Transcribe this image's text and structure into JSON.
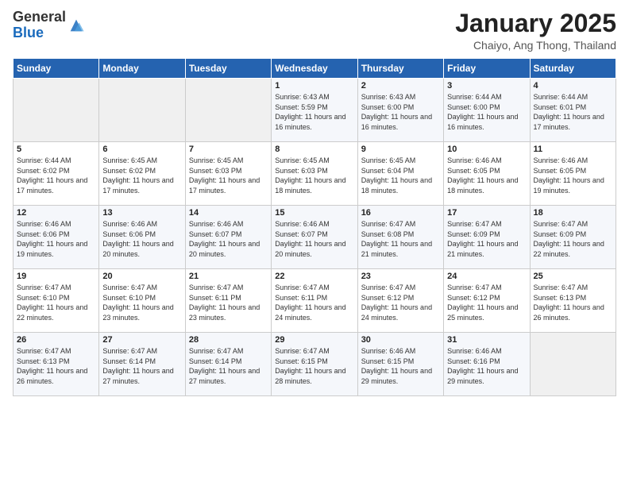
{
  "logo": {
    "general": "General",
    "blue": "Blue"
  },
  "header": {
    "month": "January 2025",
    "location": "Chaiyo, Ang Thong, Thailand"
  },
  "weekdays": [
    "Sunday",
    "Monday",
    "Tuesday",
    "Wednesday",
    "Thursday",
    "Friday",
    "Saturday"
  ],
  "weeks": [
    [
      {
        "day": "",
        "sunrise": "",
        "sunset": "",
        "daylight": ""
      },
      {
        "day": "",
        "sunrise": "",
        "sunset": "",
        "daylight": ""
      },
      {
        "day": "",
        "sunrise": "",
        "sunset": "",
        "daylight": ""
      },
      {
        "day": "1",
        "sunrise": "6:43 AM",
        "sunset": "5:59 PM",
        "daylight": "11 hours and 16 minutes."
      },
      {
        "day": "2",
        "sunrise": "6:43 AM",
        "sunset": "6:00 PM",
        "daylight": "11 hours and 16 minutes."
      },
      {
        "day": "3",
        "sunrise": "6:44 AM",
        "sunset": "6:00 PM",
        "daylight": "11 hours and 16 minutes."
      },
      {
        "day": "4",
        "sunrise": "6:44 AM",
        "sunset": "6:01 PM",
        "daylight": "11 hours and 17 minutes."
      }
    ],
    [
      {
        "day": "5",
        "sunrise": "6:44 AM",
        "sunset": "6:02 PM",
        "daylight": "11 hours and 17 minutes."
      },
      {
        "day": "6",
        "sunrise": "6:45 AM",
        "sunset": "6:02 PM",
        "daylight": "11 hours and 17 minutes."
      },
      {
        "day": "7",
        "sunrise": "6:45 AM",
        "sunset": "6:03 PM",
        "daylight": "11 hours and 17 minutes."
      },
      {
        "day": "8",
        "sunrise": "6:45 AM",
        "sunset": "6:03 PM",
        "daylight": "11 hours and 18 minutes."
      },
      {
        "day": "9",
        "sunrise": "6:45 AM",
        "sunset": "6:04 PM",
        "daylight": "11 hours and 18 minutes."
      },
      {
        "day": "10",
        "sunrise": "6:46 AM",
        "sunset": "6:05 PM",
        "daylight": "11 hours and 18 minutes."
      },
      {
        "day": "11",
        "sunrise": "6:46 AM",
        "sunset": "6:05 PM",
        "daylight": "11 hours and 19 minutes."
      }
    ],
    [
      {
        "day": "12",
        "sunrise": "6:46 AM",
        "sunset": "6:06 PM",
        "daylight": "11 hours and 19 minutes."
      },
      {
        "day": "13",
        "sunrise": "6:46 AM",
        "sunset": "6:06 PM",
        "daylight": "11 hours and 20 minutes."
      },
      {
        "day": "14",
        "sunrise": "6:46 AM",
        "sunset": "6:07 PM",
        "daylight": "11 hours and 20 minutes."
      },
      {
        "day": "15",
        "sunrise": "6:46 AM",
        "sunset": "6:07 PM",
        "daylight": "11 hours and 20 minutes."
      },
      {
        "day": "16",
        "sunrise": "6:47 AM",
        "sunset": "6:08 PM",
        "daylight": "11 hours and 21 minutes."
      },
      {
        "day": "17",
        "sunrise": "6:47 AM",
        "sunset": "6:09 PM",
        "daylight": "11 hours and 21 minutes."
      },
      {
        "day": "18",
        "sunrise": "6:47 AM",
        "sunset": "6:09 PM",
        "daylight": "11 hours and 22 minutes."
      }
    ],
    [
      {
        "day": "19",
        "sunrise": "6:47 AM",
        "sunset": "6:10 PM",
        "daylight": "11 hours and 22 minutes."
      },
      {
        "day": "20",
        "sunrise": "6:47 AM",
        "sunset": "6:10 PM",
        "daylight": "11 hours and 23 minutes."
      },
      {
        "day": "21",
        "sunrise": "6:47 AM",
        "sunset": "6:11 PM",
        "daylight": "11 hours and 23 minutes."
      },
      {
        "day": "22",
        "sunrise": "6:47 AM",
        "sunset": "6:11 PM",
        "daylight": "11 hours and 24 minutes."
      },
      {
        "day": "23",
        "sunrise": "6:47 AM",
        "sunset": "6:12 PM",
        "daylight": "11 hours and 24 minutes."
      },
      {
        "day": "24",
        "sunrise": "6:47 AM",
        "sunset": "6:12 PM",
        "daylight": "11 hours and 25 minutes."
      },
      {
        "day": "25",
        "sunrise": "6:47 AM",
        "sunset": "6:13 PM",
        "daylight": "11 hours and 26 minutes."
      }
    ],
    [
      {
        "day": "26",
        "sunrise": "6:47 AM",
        "sunset": "6:13 PM",
        "daylight": "11 hours and 26 minutes."
      },
      {
        "day": "27",
        "sunrise": "6:47 AM",
        "sunset": "6:14 PM",
        "daylight": "11 hours and 27 minutes."
      },
      {
        "day": "28",
        "sunrise": "6:47 AM",
        "sunset": "6:14 PM",
        "daylight": "11 hours and 27 minutes."
      },
      {
        "day": "29",
        "sunrise": "6:47 AM",
        "sunset": "6:15 PM",
        "daylight": "11 hours and 28 minutes."
      },
      {
        "day": "30",
        "sunrise": "6:46 AM",
        "sunset": "6:15 PM",
        "daylight": "11 hours and 29 minutes."
      },
      {
        "day": "31",
        "sunrise": "6:46 AM",
        "sunset": "6:16 PM",
        "daylight": "11 hours and 29 minutes."
      },
      {
        "day": "",
        "sunrise": "",
        "sunset": "",
        "daylight": ""
      }
    ]
  ]
}
